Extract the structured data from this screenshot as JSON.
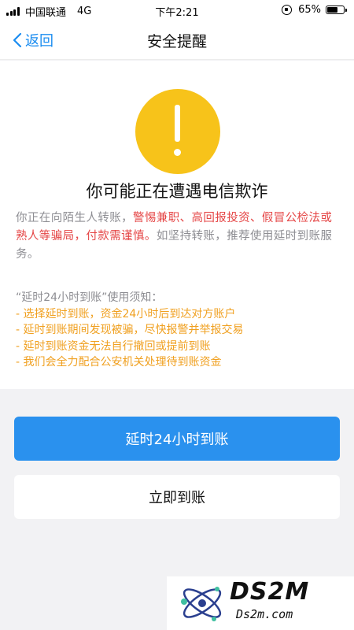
{
  "status_bar": {
    "carrier": "中国联通",
    "network": "4G",
    "time": "下午2:21",
    "battery": "65%",
    "battery_level": 0.65
  },
  "nav": {
    "back_label": "返回",
    "title": "安全提醒"
  },
  "warning": {
    "headline": "你可能正在遭遇电信欺诈",
    "desc_prefix": "你正在向陌生人转账，",
    "desc_highlight": "警惕兼职、高回报投资、假冒公检法或熟人等骗局，付款需谨慎。",
    "desc_suffix": "如坚持转账，推荐使用延时到账服务。"
  },
  "notice": {
    "title": "“延时24小时到账”使用须知：",
    "items": [
      "- 选择延时到账，资金24小时后到达对方账户",
      "- 延时到账期间发现被骗，尽快报警并举报交易",
      "- 延时到账资金无法自行撤回或提前到账",
      "- 我们会全力配合公安机关处理待到账资金"
    ]
  },
  "buttons": {
    "delay_label": "延时24小时到账",
    "instant_label": "立即到账"
  },
  "watermark": {
    "brand": "DS2M",
    "site": "Ds2m.com"
  },
  "colors": {
    "accent": "#2a91ee",
    "warning_yellow": "#f7c31a",
    "danger_red": "#e54646",
    "notice_orange": "#f0a020"
  }
}
